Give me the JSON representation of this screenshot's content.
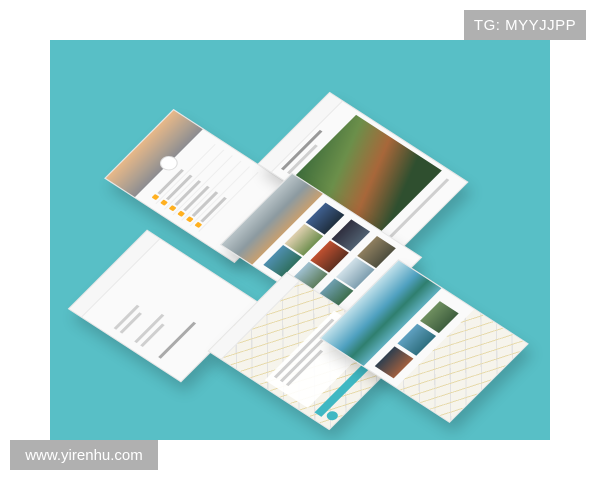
{
  "watermark": {
    "top": "TG: MYYJJPP",
    "bottom": "www.yirenhu.com"
  },
  "colors": {
    "background": "#58bfc6",
    "accent": "#3fb8c3",
    "icon_accent": "#ffb020"
  }
}
